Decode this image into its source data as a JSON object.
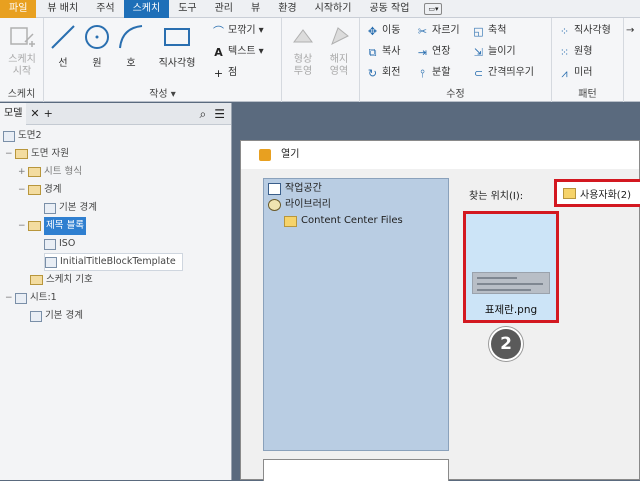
{
  "menubar": {
    "items": [
      "파일",
      "뷰 배치",
      "주석",
      "스케치",
      "도구",
      "관리",
      "뷰",
      "환경",
      "시작하기",
      "공동 작업"
    ],
    "active": "스케치"
  },
  "ribbon": {
    "sketch_group": {
      "start_sketch": "스케치 시작",
      "label": "스케치"
    },
    "create_group": {
      "line": "선",
      "circle": "원",
      "arc": "호",
      "rectangle": "직사각형",
      "fillet": "모깎기",
      "text": "텍스트",
      "point": "점",
      "label": "작성"
    },
    "pattern_group": {
      "project": "형상 투영",
      "release": "해지 영역"
    },
    "modify_group": {
      "move": "이동",
      "copy": "복사",
      "rotate": "회전",
      "trim": "자르기",
      "extend": "연장",
      "split": "분할",
      "scale": "축척",
      "stretch": "늘이기",
      "offset": "간격띄우기",
      "label": "수정"
    },
    "layout_group": {
      "rect_pattern": "직사각형",
      "circ_pattern": "원형",
      "mirror": "미러",
      "label": "패턴"
    },
    "colors": {
      "accent": "#1e6fb8",
      "file_tab": "#e8a020"
    }
  },
  "panel": {
    "tab": "모델",
    "tree": [
      {
        "label": "도면2"
      },
      {
        "label": "도면 자원"
      },
      {
        "label": "시트 형식"
      },
      {
        "label": "경계"
      },
      {
        "label": "기본 경계"
      },
      {
        "label": "제목 블록"
      },
      {
        "label": "ISO"
      },
      {
        "label": "InitialTitleBlockTemplate"
      },
      {
        "label": "스케치 기호"
      },
      {
        "label": "시트:1"
      },
      {
        "label": "기본 경계"
      }
    ]
  },
  "dialog": {
    "title": "열기",
    "locations": [
      "작업공간",
      "라이브러리",
      "Content Center Files"
    ],
    "look_in_label": "찾는 위치(I):",
    "look_in_value": "사용자화(2)",
    "file_name": "표제란.png",
    "step_number": "2",
    "highlight_color": "#d31820"
  }
}
